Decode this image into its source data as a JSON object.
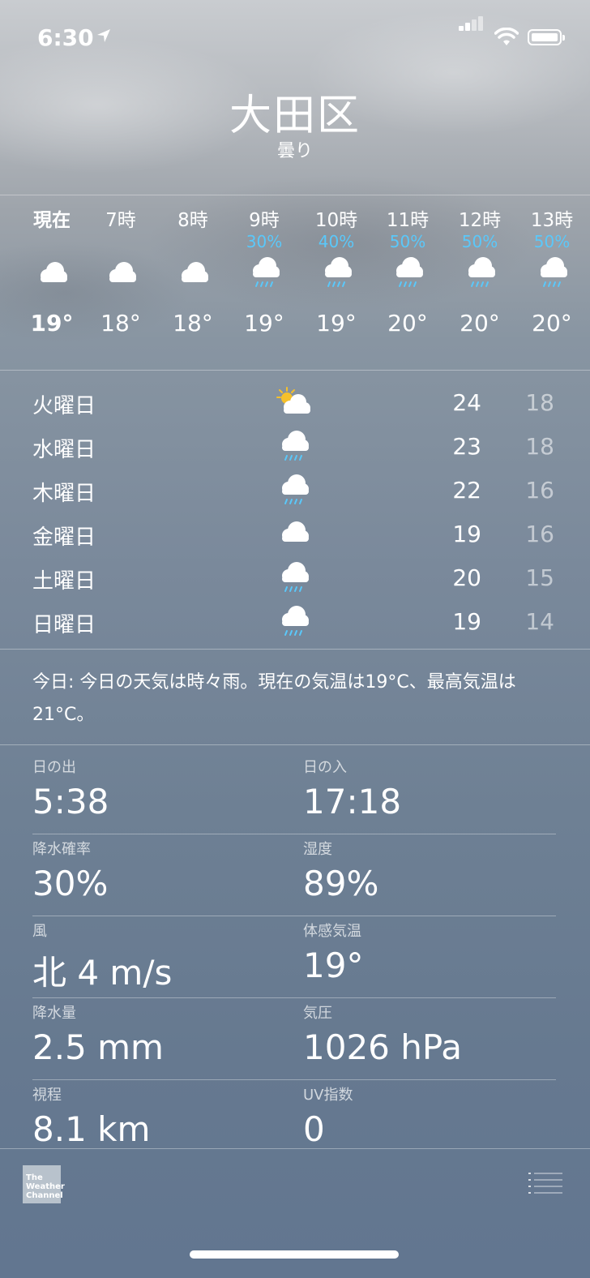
{
  "status_bar": {
    "time": "6:30"
  },
  "location": {
    "city": "大田区",
    "condition": "曇り"
  },
  "hourly": [
    {
      "label": "現在",
      "pop": "",
      "icon": "cloud-icon",
      "temp": "19°"
    },
    {
      "label": "7時",
      "pop": "",
      "icon": "cloud-icon",
      "temp": "18°"
    },
    {
      "label": "8時",
      "pop": "",
      "icon": "cloud-icon",
      "temp": "18°"
    },
    {
      "label": "9時",
      "pop": "30%",
      "icon": "cloud-rain-icon",
      "temp": "19°"
    },
    {
      "label": "10時",
      "pop": "40%",
      "icon": "cloud-rain-icon",
      "temp": "19°"
    },
    {
      "label": "11時",
      "pop": "50%",
      "icon": "cloud-rain-icon",
      "temp": "20°"
    },
    {
      "label": "12時",
      "pop": "50%",
      "icon": "cloud-rain-icon",
      "temp": "20°"
    },
    {
      "label": "13時",
      "pop": "50%",
      "icon": "cloud-rain-icon",
      "temp": "20°"
    }
  ],
  "daily": [
    {
      "day": "火曜日",
      "icon": "sun-cloud-icon",
      "high": "24",
      "low": "18"
    },
    {
      "day": "水曜日",
      "icon": "cloud-rain-icon",
      "high": "23",
      "low": "18"
    },
    {
      "day": "木曜日",
      "icon": "cloud-rain-icon",
      "high": "22",
      "low": "16"
    },
    {
      "day": "金曜日",
      "icon": "cloud-icon",
      "high": "19",
      "low": "16"
    },
    {
      "day": "土曜日",
      "icon": "cloud-rain-icon",
      "high": "20",
      "low": "15"
    },
    {
      "day": "日曜日",
      "icon": "cloud-rain-icon",
      "high": "19",
      "low": "14"
    }
  ],
  "summary": "今日: 今日の天気は時々雨。現在の気温は19°C、最高気温は21°C。",
  "details": [
    {
      "left": {
        "key": "日の出",
        "value": "5:38"
      },
      "right": {
        "key": "日の入",
        "value": "17:18"
      }
    },
    {
      "left": {
        "key": "降水確率",
        "value": "30%"
      },
      "right": {
        "key": "湿度",
        "value": "89%"
      }
    },
    {
      "left": {
        "key": "風",
        "value": "北 4 m/s"
      },
      "right": {
        "key": "体感気温",
        "value": "19°"
      }
    },
    {
      "left": {
        "key": "降水量",
        "value": "2.5 mm"
      },
      "right": {
        "key": "気圧",
        "value": "1026 hPa"
      }
    },
    {
      "left": {
        "key": "視程",
        "value": "8.1 km"
      },
      "right": {
        "key": "UV指数",
        "value": "0"
      }
    }
  ],
  "footer": {
    "logo_text": "The Weather Channel"
  },
  "colors": {
    "precip": "#5ac8fa",
    "sun": "#f5c02b"
  }
}
